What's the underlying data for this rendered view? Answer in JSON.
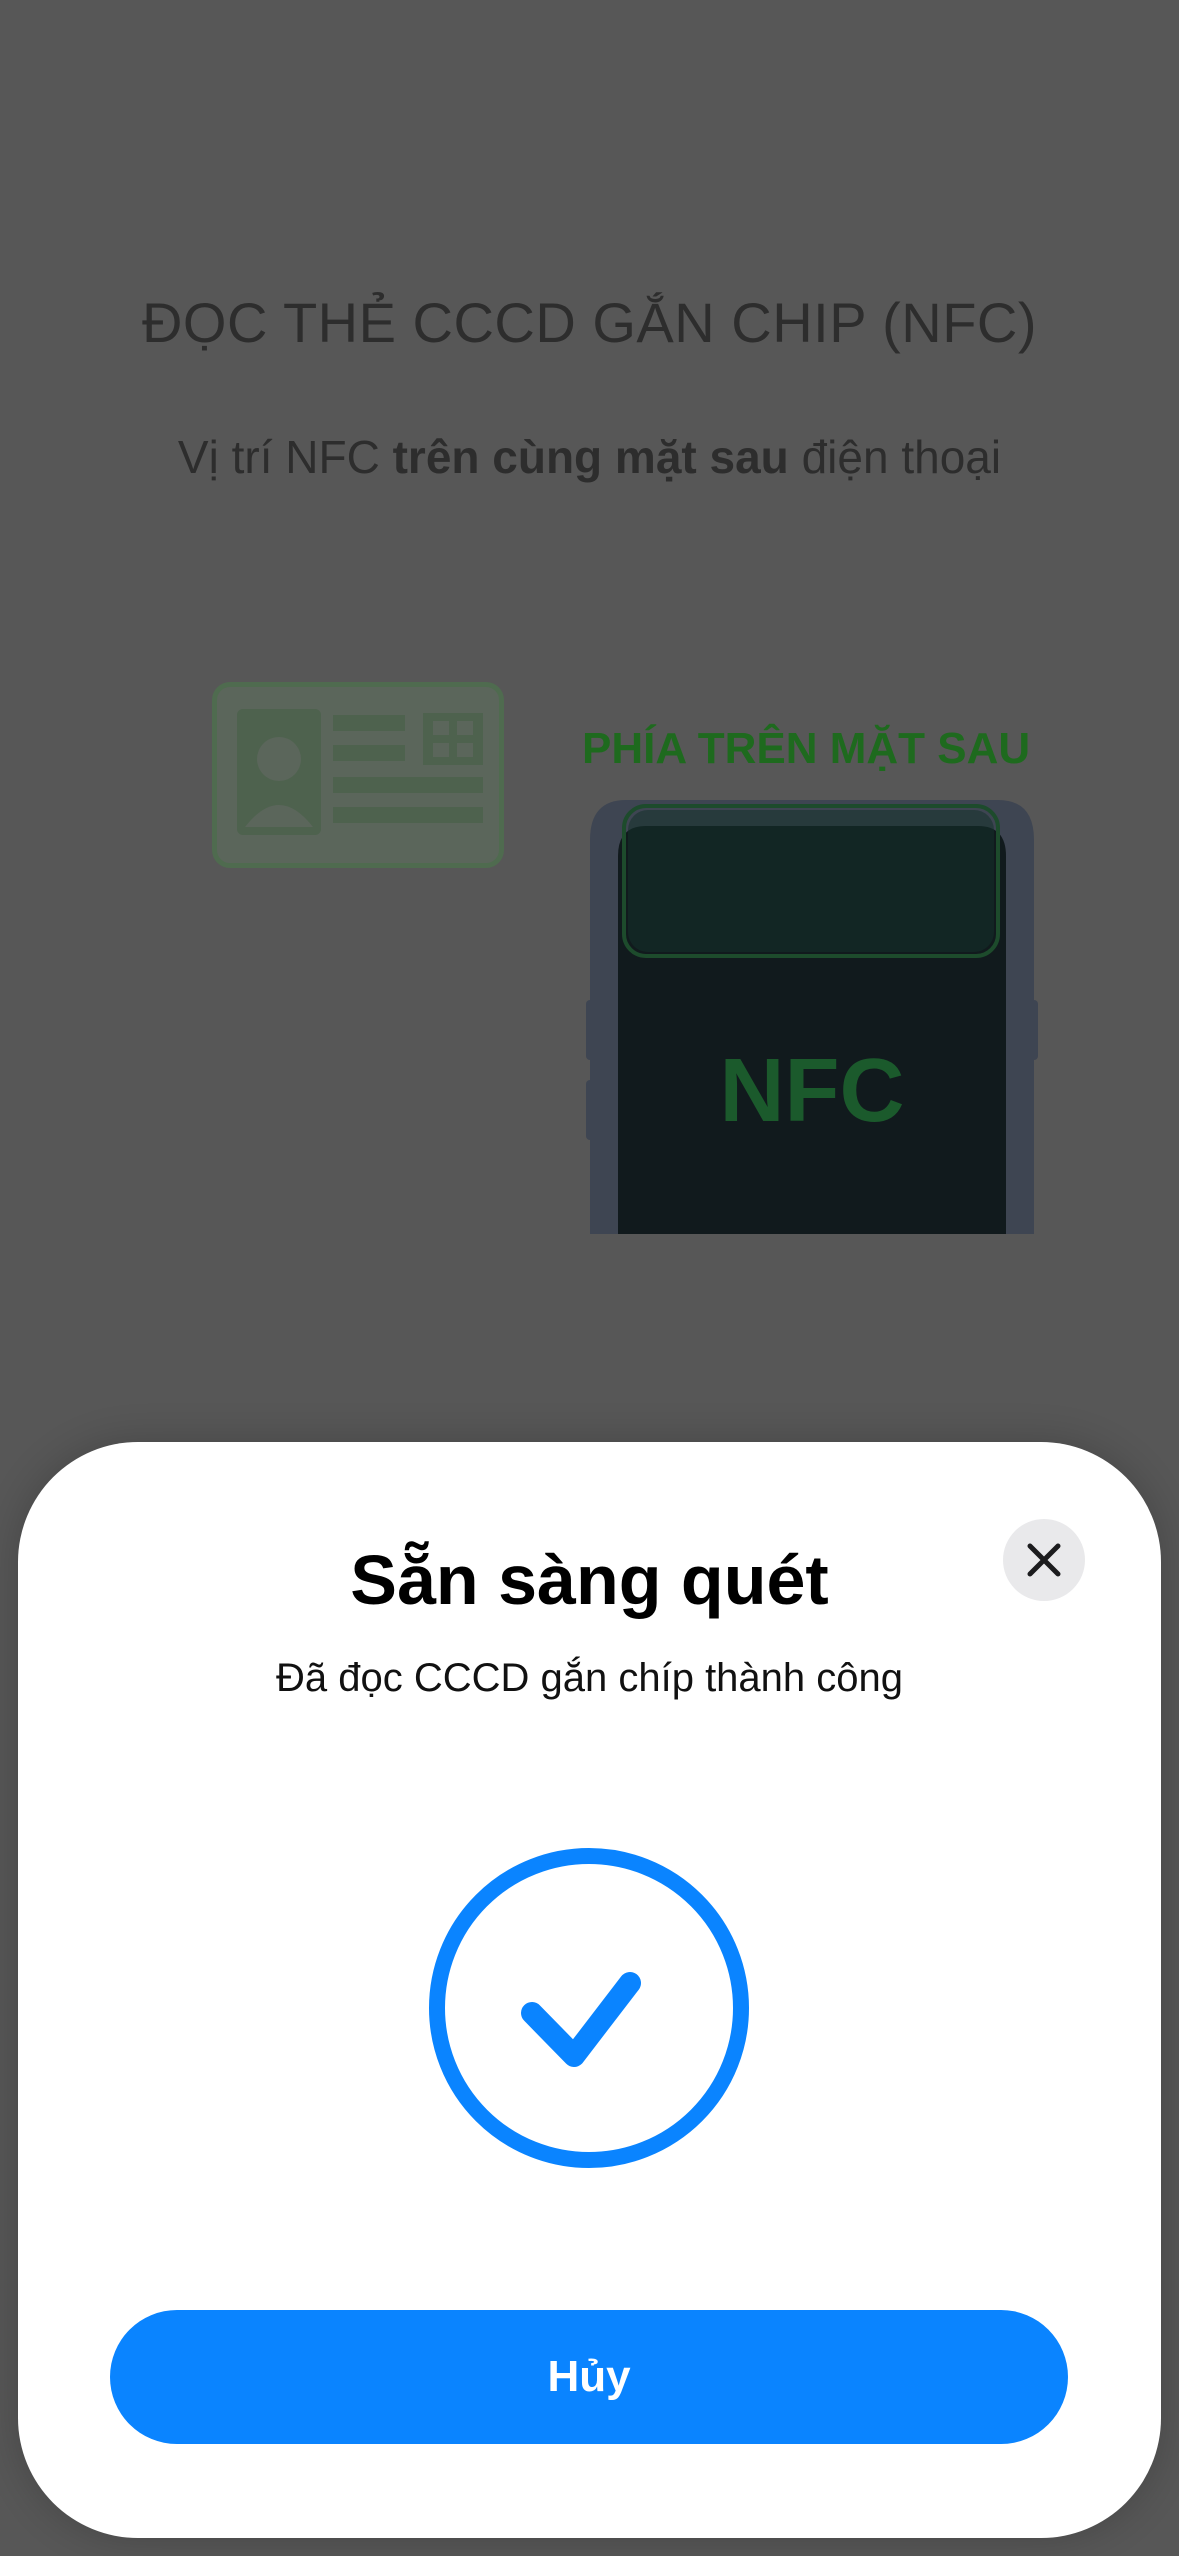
{
  "screen": {
    "title": "ĐỌC THẺ CCCD GẮN CHIP (NFC)",
    "subtitle_prefix": "Vị trí NFC ",
    "subtitle_bold": "trên cùng mặt sau",
    "subtitle_suffix": " điện thoại",
    "illustration": {
      "label": "PHÍA TRÊN MẶT SAU",
      "phone_text": "NFC"
    }
  },
  "sheet": {
    "title": "Sẵn sàng quét",
    "message": "Đã đọc CCCD gắn chíp thành công",
    "cancel_label": "Hủy",
    "status_icon": "checkmark-circle-icon",
    "close_icon": "close-icon"
  },
  "colors": {
    "accent": "#0a84ff",
    "illustration_green": "#1e6a1e",
    "overlay": "#575757"
  }
}
